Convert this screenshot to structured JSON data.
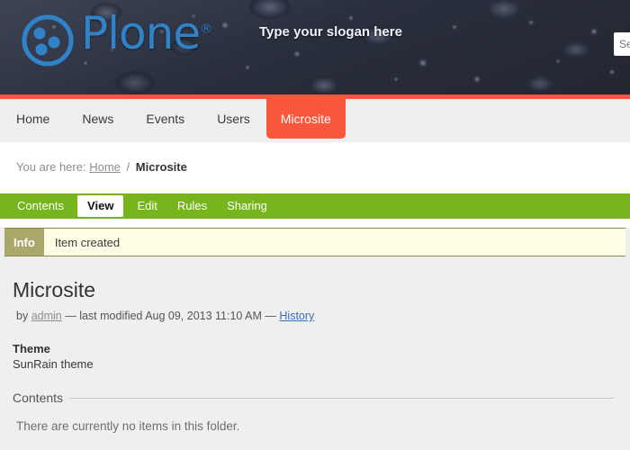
{
  "banner": {
    "logo_icon": "plone-logo-icon",
    "wordmark": "Plone",
    "wordmark_mark": "®",
    "slogan": "Type your slogan here",
    "search_placeholder": "Search Site",
    "search_value": "",
    "accent_color": "#f9573b",
    "logo_color": "#3083c8"
  },
  "globalnav": {
    "items": [
      {
        "label": "Home",
        "selected": false
      },
      {
        "label": "News",
        "selected": false
      },
      {
        "label": "Events",
        "selected": false
      },
      {
        "label": "Users",
        "selected": false
      },
      {
        "label": "Microsite",
        "selected": true
      }
    ]
  },
  "breadcrumb": {
    "prefix": "You are here:",
    "home": "Home",
    "separator": "/",
    "current": "Microsite"
  },
  "contentviews": {
    "accent_color": "#76b51b",
    "items": [
      {
        "label": "Contents",
        "selected": false
      },
      {
        "label": "View",
        "selected": true
      },
      {
        "label": "Edit",
        "selected": false
      },
      {
        "label": "Rules",
        "selected": false
      },
      {
        "label": "Sharing",
        "selected": false
      }
    ]
  },
  "message": {
    "level": "Info",
    "text": "Item created",
    "badge_color": "#a9a86a",
    "background_color": "#ffffe6"
  },
  "document": {
    "title": "Microsite",
    "byline": {
      "by": "by",
      "author": "admin",
      "dash": "—",
      "modified_label": "last modified",
      "modified_date": "Aug 09, 2013 11:10 AM",
      "dash2": "—",
      "history": "History"
    },
    "fields": [
      {
        "label": "Theme",
        "value": "SunRain theme"
      }
    ],
    "contents_heading": "Contents",
    "empty_message": "There are currently no items in this folder."
  }
}
